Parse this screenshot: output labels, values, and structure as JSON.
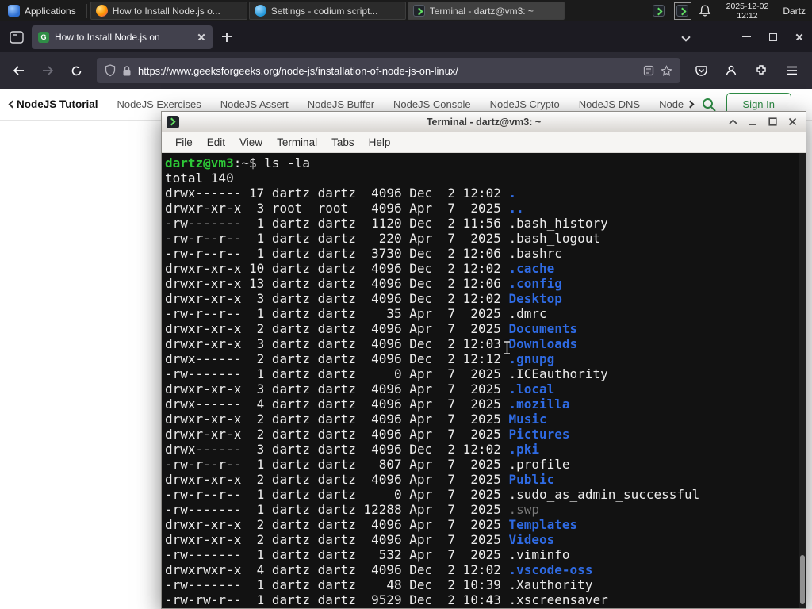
{
  "colors": {
    "gfg_green": "#2f8d46",
    "dir_blue": "#2f6be4",
    "prompt_green": "#2dc937",
    "firefox_tab": "#42414d",
    "terminal_bg": "#121212"
  },
  "panel": {
    "applications_label": "Applications",
    "windows": [
      {
        "title": "How to Install Node.js o...",
        "icon": "firefox-icon"
      },
      {
        "title": "Settings - codium script...",
        "icon": "codium-icon"
      },
      {
        "title": "Terminal - dartz@vm3: ~",
        "icon": "terminal-icon"
      }
    ],
    "clock_date": "2025-12-02",
    "clock_time": "12:12",
    "user_label": "Dartz"
  },
  "browser": {
    "tab_title": "How to Install Node.js on",
    "url": "https://www.geeksforgeeks.org/node-js/installation-of-node-js-on-linux/"
  },
  "site_nav": {
    "items": [
      "NodeJS Tutorial",
      "NodeJS Exercises",
      "NodeJS Assert",
      "NodeJS Buffer",
      "NodeJS Console",
      "NodeJS Crypto",
      "NodeJS DNS",
      "Node"
    ],
    "sign_in_label": "Sign In"
  },
  "terminal": {
    "window_title": "Terminal - dartz@vm3: ~",
    "menu": [
      "File",
      "Edit",
      "View",
      "Terminal",
      "Tabs",
      "Help"
    ],
    "prompt_user_host": "dartz@vm3",
    "prompt_suffix": ":~$",
    "command": "ls -la",
    "total_line": "total 140",
    "rows": [
      {
        "perms": "drwx------",
        "links": "17",
        "owner": "dartz",
        "group": "dartz",
        "size": "4096",
        "month": "Dec",
        "day": "2",
        "time": "12:02",
        "name": ".",
        "kind": "dir"
      },
      {
        "perms": "drwxr-xr-x",
        "links": "3",
        "owner": "root",
        "group": "root",
        "size": "4096",
        "month": "Apr",
        "day": "7",
        "time": "2025",
        "name": "..",
        "kind": "dir"
      },
      {
        "perms": "-rw-------",
        "links": "1",
        "owner": "dartz",
        "group": "dartz",
        "size": "1120",
        "month": "Dec",
        "day": "2",
        "time": "11:56",
        "name": ".bash_history",
        "kind": "file"
      },
      {
        "perms": "-rw-r--r--",
        "links": "1",
        "owner": "dartz",
        "group": "dartz",
        "size": "220",
        "month": "Apr",
        "day": "7",
        "time": "2025",
        "name": ".bash_logout",
        "kind": "file"
      },
      {
        "perms": "-rw-r--r--",
        "links": "1",
        "owner": "dartz",
        "group": "dartz",
        "size": "3730",
        "month": "Dec",
        "day": "2",
        "time": "12:06",
        "name": ".bashrc",
        "kind": "file"
      },
      {
        "perms": "drwxr-xr-x",
        "links": "10",
        "owner": "dartz",
        "group": "dartz",
        "size": "4096",
        "month": "Dec",
        "day": "2",
        "time": "12:02",
        "name": ".cache",
        "kind": "dir"
      },
      {
        "perms": "drwxr-xr-x",
        "links": "13",
        "owner": "dartz",
        "group": "dartz",
        "size": "4096",
        "month": "Dec",
        "day": "2",
        "time": "12:06",
        "name": ".config",
        "kind": "dir"
      },
      {
        "perms": "drwxr-xr-x",
        "links": "3",
        "owner": "dartz",
        "group": "dartz",
        "size": "4096",
        "month": "Dec",
        "day": "2",
        "time": "12:02",
        "name": "Desktop",
        "kind": "dir"
      },
      {
        "perms": "-rw-r--r--",
        "links": "1",
        "owner": "dartz",
        "group": "dartz",
        "size": "35",
        "month": "Apr",
        "day": "7",
        "time": "2025",
        "name": ".dmrc",
        "kind": "file"
      },
      {
        "perms": "drwxr-xr-x",
        "links": "2",
        "owner": "dartz",
        "group": "dartz",
        "size": "4096",
        "month": "Apr",
        "day": "7",
        "time": "2025",
        "name": "Documents",
        "kind": "dir"
      },
      {
        "perms": "drwxr-xr-x",
        "links": "3",
        "owner": "dartz",
        "group": "dartz",
        "size": "4096",
        "month": "Dec",
        "day": "2",
        "time": "12:03",
        "name": "Downloads",
        "kind": "dir"
      },
      {
        "perms": "drwx------",
        "links": "2",
        "owner": "dartz",
        "group": "dartz",
        "size": "4096",
        "month": "Dec",
        "day": "2",
        "time": "12:12",
        "name": ".gnupg",
        "kind": "dir"
      },
      {
        "perms": "-rw-------",
        "links": "1",
        "owner": "dartz",
        "group": "dartz",
        "size": "0",
        "month": "Apr",
        "day": "7",
        "time": "2025",
        "name": ".ICEauthority",
        "kind": "file"
      },
      {
        "perms": "drwxr-xr-x",
        "links": "3",
        "owner": "dartz",
        "group": "dartz",
        "size": "4096",
        "month": "Apr",
        "day": "7",
        "time": "2025",
        "name": ".local",
        "kind": "dir"
      },
      {
        "perms": "drwx------",
        "links": "4",
        "owner": "dartz",
        "group": "dartz",
        "size": "4096",
        "month": "Apr",
        "day": "7",
        "time": "2025",
        "name": ".mozilla",
        "kind": "dir"
      },
      {
        "perms": "drwxr-xr-x",
        "links": "2",
        "owner": "dartz",
        "group": "dartz",
        "size": "4096",
        "month": "Apr",
        "day": "7",
        "time": "2025",
        "name": "Music",
        "kind": "dir"
      },
      {
        "perms": "drwxr-xr-x",
        "links": "2",
        "owner": "dartz",
        "group": "dartz",
        "size": "4096",
        "month": "Apr",
        "day": "7",
        "time": "2025",
        "name": "Pictures",
        "kind": "dir"
      },
      {
        "perms": "drwx------",
        "links": "3",
        "owner": "dartz",
        "group": "dartz",
        "size": "4096",
        "month": "Dec",
        "day": "2",
        "time": "12:02",
        "name": ".pki",
        "kind": "dir"
      },
      {
        "perms": "-rw-r--r--",
        "links": "1",
        "owner": "dartz",
        "group": "dartz",
        "size": "807",
        "month": "Apr",
        "day": "7",
        "time": "2025",
        "name": ".profile",
        "kind": "file"
      },
      {
        "perms": "drwxr-xr-x",
        "links": "2",
        "owner": "dartz",
        "group": "dartz",
        "size": "4096",
        "month": "Apr",
        "day": "7",
        "time": "2025",
        "name": "Public",
        "kind": "dir"
      },
      {
        "perms": "-rw-r--r--",
        "links": "1",
        "owner": "dartz",
        "group": "dartz",
        "size": "0",
        "month": "Apr",
        "day": "7",
        "time": "2025",
        "name": ".sudo_as_admin_successful",
        "kind": "file"
      },
      {
        "perms": "-rw-------",
        "links": "1",
        "owner": "dartz",
        "group": "dartz",
        "size": "12288",
        "month": "Apr",
        "day": "7",
        "time": "2025",
        "name": ".swp",
        "kind": "dim"
      },
      {
        "perms": "drwxr-xr-x",
        "links": "2",
        "owner": "dartz",
        "group": "dartz",
        "size": "4096",
        "month": "Apr",
        "day": "7",
        "time": "2025",
        "name": "Templates",
        "kind": "dir"
      },
      {
        "perms": "drwxr-xr-x",
        "links": "2",
        "owner": "dartz",
        "group": "dartz",
        "size": "4096",
        "month": "Apr",
        "day": "7",
        "time": "2025",
        "name": "Videos",
        "kind": "dir"
      },
      {
        "perms": "-rw-------",
        "links": "1",
        "owner": "dartz",
        "group": "dartz",
        "size": "532",
        "month": "Apr",
        "day": "7",
        "time": "2025",
        "name": ".viminfo",
        "kind": "file"
      },
      {
        "perms": "drwxrwxr-x",
        "links": "4",
        "owner": "dartz",
        "group": "dartz",
        "size": "4096",
        "month": "Dec",
        "day": "2",
        "time": "12:02",
        "name": ".vscode-oss",
        "kind": "dir"
      },
      {
        "perms": "-rw-------",
        "links": "1",
        "owner": "dartz",
        "group": "dartz",
        "size": "48",
        "month": "Dec",
        "day": "2",
        "time": "10:39",
        "name": ".Xauthority",
        "kind": "file"
      },
      {
        "perms": "-rw-rw-r--",
        "links": "1",
        "owner": "dartz",
        "group": "dartz",
        "size": "9529",
        "month": "Dec",
        "day": "2",
        "time": "10:43",
        "name": ".xscreensaver",
        "kind": "file"
      }
    ]
  },
  "icons": [
    "applications-icon",
    "firefox-icon",
    "codium-icon",
    "terminal-icon",
    "terminal-tray-icon",
    "bell-icon",
    "firefox-view-icon",
    "site-favicon",
    "tab-close-icon",
    "new-tab-icon",
    "tabs-list-chevron-icon",
    "window-minimize-icon",
    "window-maximize-icon",
    "window-close-icon",
    "back-icon",
    "forward-icon",
    "reload-icon",
    "tracking-shield-icon",
    "lock-icon",
    "reader-mode-icon",
    "bookmark-star-icon",
    "pocket-icon",
    "account-icon",
    "extensions-icon",
    "menu-icon",
    "nav-prev-chevron-icon",
    "nav-next-chevron-icon",
    "search-icon",
    "shade-icon",
    "text-cursor-icon"
  ]
}
